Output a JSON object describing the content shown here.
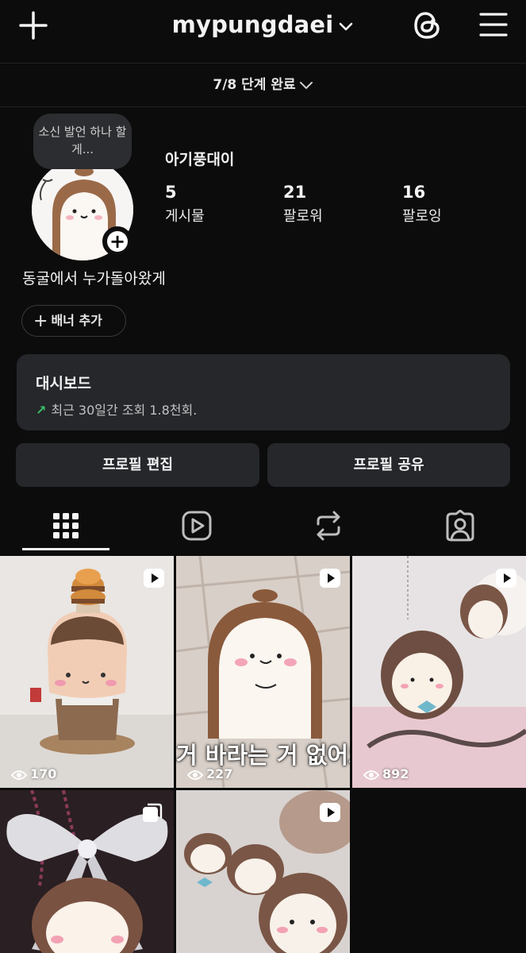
{
  "header": {
    "username": "mypungdaei",
    "icons": [
      "plus-icon",
      "chevron-down-icon",
      "threads-icon",
      "hamburger-menu-icon"
    ]
  },
  "progress": {
    "label": "7/8 단계 완료"
  },
  "profile": {
    "note": "소신 발언 하나 할게...",
    "display_name": "아기풍대이",
    "stats": [
      {
        "value": "5",
        "label": "게시물"
      },
      {
        "value": "21",
        "label": "팔로워"
      },
      {
        "value": "16",
        "label": "팔로잉"
      }
    ],
    "bio": "동굴에서 누가돌아왔게",
    "banner_button": "배너 추가"
  },
  "dashboard": {
    "title": "대시보드",
    "subtitle": "최근 30일간 조회 1.8천회."
  },
  "actions": {
    "edit": "프로필 편집",
    "share": "프로필 공유"
  },
  "tabs": [
    {
      "name": "grid",
      "icon": "grid-icon",
      "active": true
    },
    {
      "name": "reels",
      "icon": "reels-icon",
      "active": false
    },
    {
      "name": "reposts",
      "icon": "repost-icon",
      "active": false
    },
    {
      "name": "tagged",
      "icon": "tagged-icon",
      "active": false
    }
  ],
  "posts": [
    {
      "type": "reel",
      "views": "170",
      "caption": ""
    },
    {
      "type": "reel",
      "views": "227",
      "caption": "거 바라는 거 없어요"
    },
    {
      "type": "reel",
      "views": "892",
      "caption": ""
    },
    {
      "type": "carousel",
      "views": "",
      "caption": ""
    },
    {
      "type": "reel",
      "views": "",
      "caption": ""
    }
  ],
  "colors": {
    "background": "#0c0c0c",
    "surface": "#25272b",
    "trend_green": "#3cc06a"
  }
}
